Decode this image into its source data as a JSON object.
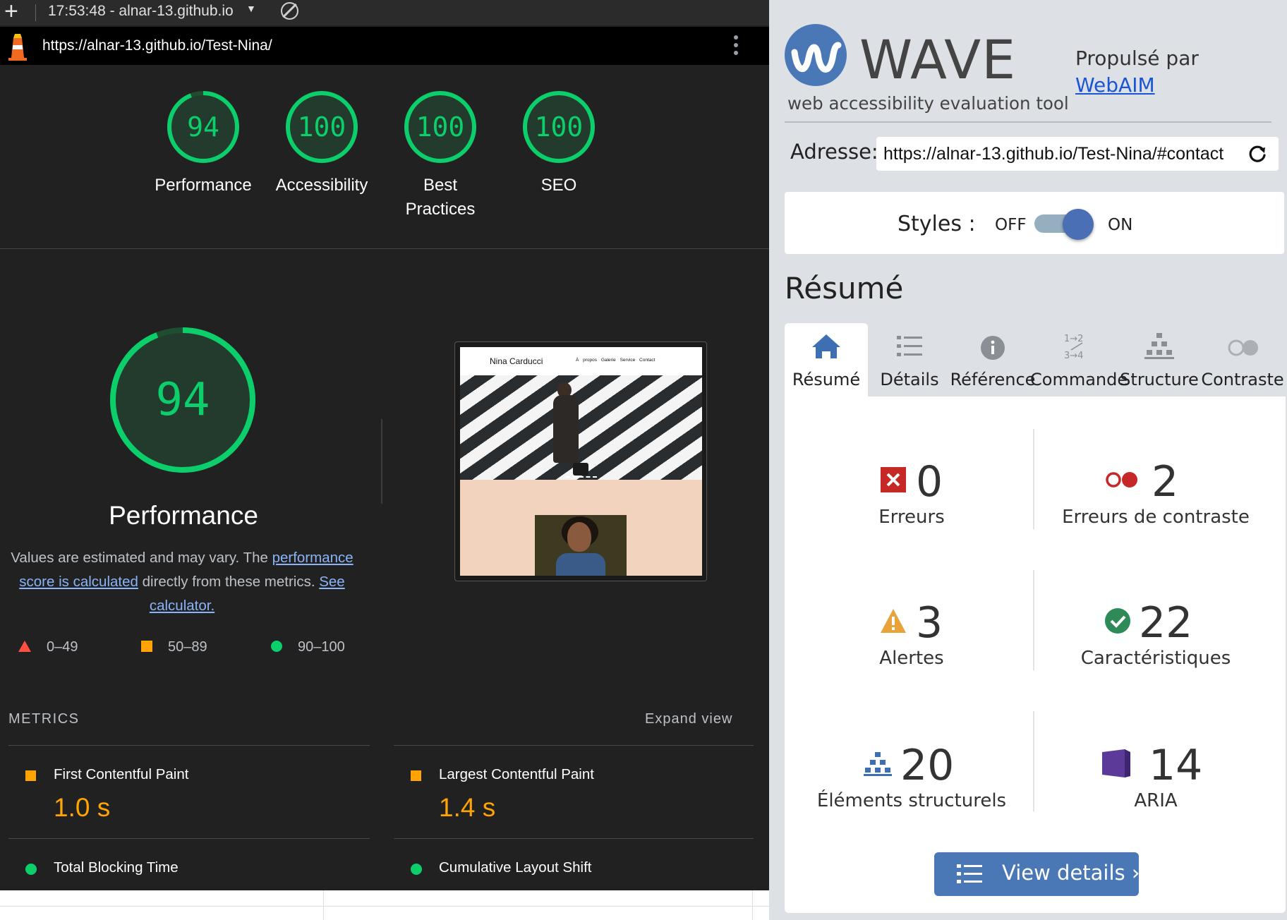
{
  "topbar": {
    "time_host": "17:53:48 - alnar-13.github.io",
    "url": "https://alnar-13.github.io/Test-Nina/"
  },
  "lighthouse": {
    "scores": [
      {
        "label": "Performance",
        "value": "94"
      },
      {
        "label": "Accessibility",
        "value": "100"
      },
      {
        "label": "Best Practices",
        "value": "100"
      },
      {
        "label": "SEO",
        "value": "100"
      }
    ],
    "performance": {
      "score": "94",
      "title": "Performance",
      "desc_prefix": "Values are estimated and may vary. The ",
      "desc_link1": "performance score is calculated",
      "desc_mid": " directly from these metrics. ",
      "desc_link2": "See calculator."
    },
    "legend": {
      "poor": "0–49",
      "average": "50–89",
      "good": "90–100"
    },
    "preview": {
      "site_name": "Nina Carducci",
      "nav_links": "À propos Galerie Service Contact"
    },
    "metrics_label": "METRICS",
    "expand_label": "Expand view",
    "metrics": [
      {
        "name": "First Contentful Paint",
        "value": "1.0 s",
        "status": "average"
      },
      {
        "name": "Largest Contentful Paint",
        "value": "1.4 s",
        "status": "average"
      },
      {
        "name": "Total Blocking Time",
        "value": "",
        "status": "good"
      },
      {
        "name": "Cumulative Layout Shift",
        "value": "",
        "status": "good"
      }
    ],
    "colors": {
      "good": "#0cce6b",
      "average": "#ffa400",
      "poor": "#ff4e42",
      "background": "#212121"
    }
  },
  "wave": {
    "title": "WAVE",
    "subtitle": "web accessibility evaluation tool",
    "powered_by": "Propulsé par",
    "webaim": "WebAIM",
    "address_label": "Adresse:",
    "address_value": "https://alnar-13.github.io/Test-Nina/#contact",
    "styles_label": "Styles :",
    "styles_off": "OFF",
    "styles_on": "ON",
    "styles_state": "on",
    "summary_heading": "Résumé",
    "tabs": [
      {
        "label": "Résumé",
        "icon": "home-icon",
        "active": true
      },
      {
        "label": "Détails",
        "icon": "list-icon",
        "active": false
      },
      {
        "label": "Référence",
        "icon": "info-icon",
        "active": false
      },
      {
        "label": "Commande",
        "icon": "order-icon",
        "active": false
      },
      {
        "label": "Structure",
        "icon": "structure-icon",
        "active": false
      },
      {
        "label": "Contraste",
        "icon": "contrast-icon",
        "active": false
      }
    ],
    "stats": [
      {
        "label": "Erreurs",
        "value": "0",
        "icon": "error-icon"
      },
      {
        "label": "Erreurs de contraste",
        "value": "2",
        "icon": "contrast-error-icon"
      },
      {
        "label": "Alertes",
        "value": "3",
        "icon": "alert-icon"
      },
      {
        "label": "Caractéristiques",
        "value": "22",
        "icon": "feature-icon"
      },
      {
        "label": "Éléments structurels",
        "value": "20",
        "icon": "structural-icon"
      },
      {
        "label": "ARIA",
        "value": "14",
        "icon": "aria-icon"
      }
    ],
    "view_details": "View details ›",
    "colors": {
      "accent": "#4a77b5",
      "panel_bg": "#dde1e6",
      "error": "#d32f2f",
      "alert": "#e8a33b",
      "feature": "#2e8b57",
      "aria": "#5b3a9a"
    }
  }
}
